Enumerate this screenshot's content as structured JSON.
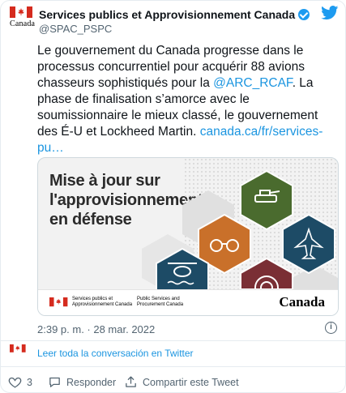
{
  "author": {
    "name": "Services publics et Approvisionnement Canada",
    "handle": "@SPAC_PSPC",
    "avatar_wordmark": "Canada"
  },
  "tweet": {
    "text_1": "Le gouvernement du Canada progresse dans le processus concurrentiel pour acquérir 88 avions chasseurs sophistiqués pour la ",
    "mention": "@ARC_RCAF",
    "text_2": ". La phase de finalisation s’amorce avec le soumissionnaire le mieux classé, le gouvernement des É-U et Lockheed Martin. ",
    "link": "canada.ca/fr/services-pu…"
  },
  "media": {
    "headline_1": "Mise à jour sur",
    "headline_2": "l'approvisionnement",
    "headline_3": "en défense",
    "footer_fr_1": "Services publics et",
    "footer_fr_2": "Approvisionnement Canada",
    "footer_en_1": "Public Services and",
    "footer_en_2": "Procurement Canada",
    "wordmark": "Canada",
    "hex_colors": [
      "#4a6b2e",
      "#c9702a",
      "#1d4b66",
      "#7a2f35"
    ]
  },
  "timestamp": "2:39 p. m. · 28 mar. 2022",
  "read_conversation": "Leer toda la conversación en Twitter",
  "actions": {
    "like_count": "3",
    "reply_label": "Responder",
    "share_label": "Compartir este Tweet"
  },
  "colors": {
    "link": "#1b95e0",
    "verified": "#1d9bf0",
    "twitter_blue": "#1d9bf0",
    "canada_red": "#d52b1e"
  }
}
